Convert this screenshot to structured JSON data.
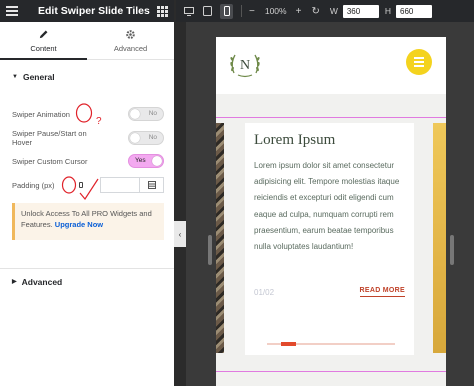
{
  "panel": {
    "title": "Edit Swiper Slide Tiles",
    "tabs": [
      {
        "label": "Content",
        "icon": "pencil-icon",
        "active": true
      },
      {
        "label": "Advanced",
        "icon": "gear-icon",
        "active": false
      }
    ],
    "sections": {
      "general": "General",
      "advanced": "Advanced"
    },
    "controls": {
      "swiper_animation": {
        "label": "Swiper Animation",
        "value": "No"
      },
      "pause_start": {
        "label": "Swiper Pause/Start on Hover",
        "value": "No"
      },
      "custom_cursor": {
        "label": "Swiper Custom Cursor",
        "value": "Yes"
      },
      "padding": {
        "label": "Padding (px)",
        "value": ""
      }
    },
    "pro_notice": {
      "text": "Unlock Access To All PRO Widgets and Features.",
      "link": "Upgrade Now"
    }
  },
  "topbar": {
    "devices": [
      "desktop-icon",
      "tablet-icon",
      "mobile-icon"
    ],
    "active_device": "mobile",
    "zoom": "100%",
    "width_label": "W",
    "width_value": "360",
    "height_label": "H",
    "height_value": "660"
  },
  "site": {
    "logo_letter": "N"
  },
  "slide": {
    "title": "Lorem Ipsum",
    "body": "Lorem ipsum dolor sit amet consectetur adipisicing elit. Tempore molestias itaque reiciendis et excepturi odit eligendi cum eaque ad culpa, numquam corrupti rem praesentium, earum beatae temporibus nulla voluptates laudantium!",
    "counter": "01/02",
    "read_more": "READ MORE",
    "progress": 0.12
  },
  "colors": {
    "accent_yellow": "#f4d31e",
    "toggle_on": "#f3a9f0",
    "read_more": "#c0432a",
    "progress": "#e2492b",
    "upgrade_link": "#0b5fd6"
  }
}
